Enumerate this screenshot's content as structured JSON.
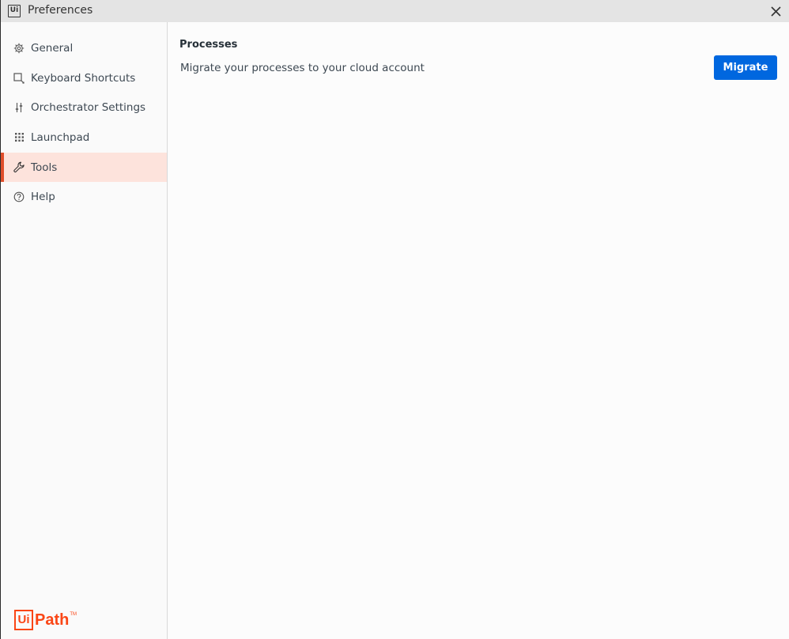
{
  "window": {
    "title": "Preferences",
    "app_icon_text": "Ui"
  },
  "sidebar": {
    "items": [
      {
        "label": "General",
        "icon": "gear-icon",
        "active": false
      },
      {
        "label": "Keyboard Shortcuts",
        "icon": "keyboard-shortcut-icon",
        "active": false
      },
      {
        "label": "Orchestrator Settings",
        "icon": "sliders-icon",
        "active": false
      },
      {
        "label": "Launchpad",
        "icon": "grid-icon",
        "active": false
      },
      {
        "label": "Tools",
        "icon": "wrench-icon",
        "active": true
      },
      {
        "label": "Help",
        "icon": "help-circle-icon",
        "active": false
      }
    ],
    "logo": {
      "box_text": "Ui",
      "text": "Path",
      "tm": "TM"
    }
  },
  "main": {
    "section_title": "Processes",
    "description": "Migrate your processes to your cloud account",
    "migrate_button": "Migrate"
  },
  "colors": {
    "accent": "#0067df",
    "brand": "#fa4616",
    "active_bg": "#fde3dc",
    "active_bar": "#e04e2a"
  }
}
